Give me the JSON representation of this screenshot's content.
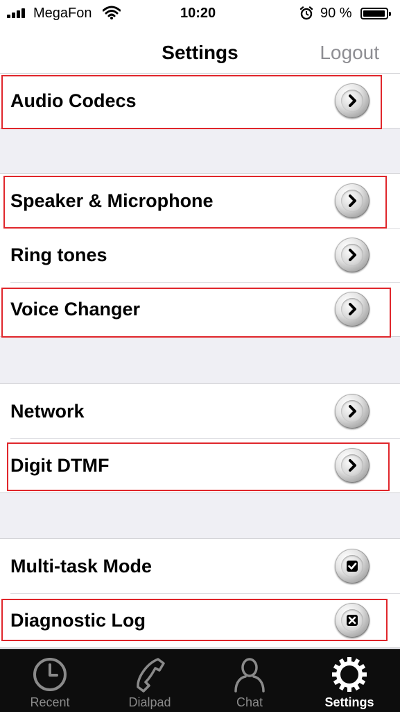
{
  "status_bar": {
    "carrier": "MegaFon",
    "time": "10:20",
    "battery_percent": "90 %",
    "battery_level": 0.9,
    "icons": [
      "signal-icon",
      "wifi-icon",
      "alarm-icon",
      "battery-icon"
    ]
  },
  "nav": {
    "title": "Settings",
    "logout_label": "Logout"
  },
  "groups": [
    {
      "items": [
        {
          "label": "Audio Codecs",
          "control": "chevron-icon",
          "highlighted": true
        }
      ]
    },
    {
      "items": [
        {
          "label": "Speaker & Microphone",
          "control": "chevron-icon",
          "highlighted": true
        },
        {
          "label": "Ring tones",
          "control": "chevron-icon",
          "highlighted": false
        },
        {
          "label": "Voice Changer",
          "control": "chevron-icon",
          "highlighted": true
        }
      ]
    },
    {
      "items": [
        {
          "label": "Network",
          "control": "chevron-icon",
          "highlighted": false
        },
        {
          "label": "Digit DTMF",
          "control": "chevron-icon",
          "highlighted": true
        }
      ]
    },
    {
      "items": [
        {
          "label": "Multi-task Mode",
          "control": "checkbox-checked-icon",
          "checked": true,
          "highlighted": false
        },
        {
          "label": "Diagnostic Log",
          "control": "checkbox-crossed-icon",
          "checked": false,
          "highlighted": true
        }
      ]
    }
  ],
  "tabs": [
    {
      "label": "Recent",
      "icon": "clock-icon",
      "active": false
    },
    {
      "label": "Dialpad",
      "icon": "phone-handset-icon",
      "active": false
    },
    {
      "label": "Chat",
      "icon": "person-icon",
      "active": false
    },
    {
      "label": "Settings",
      "icon": "gear-icon",
      "active": true
    }
  ],
  "colors": {
    "highlight_box": "#e0262b",
    "background": "#efeff4",
    "tabbar_bg": "#0d0d0d",
    "logout_text": "#8e8e93"
  }
}
